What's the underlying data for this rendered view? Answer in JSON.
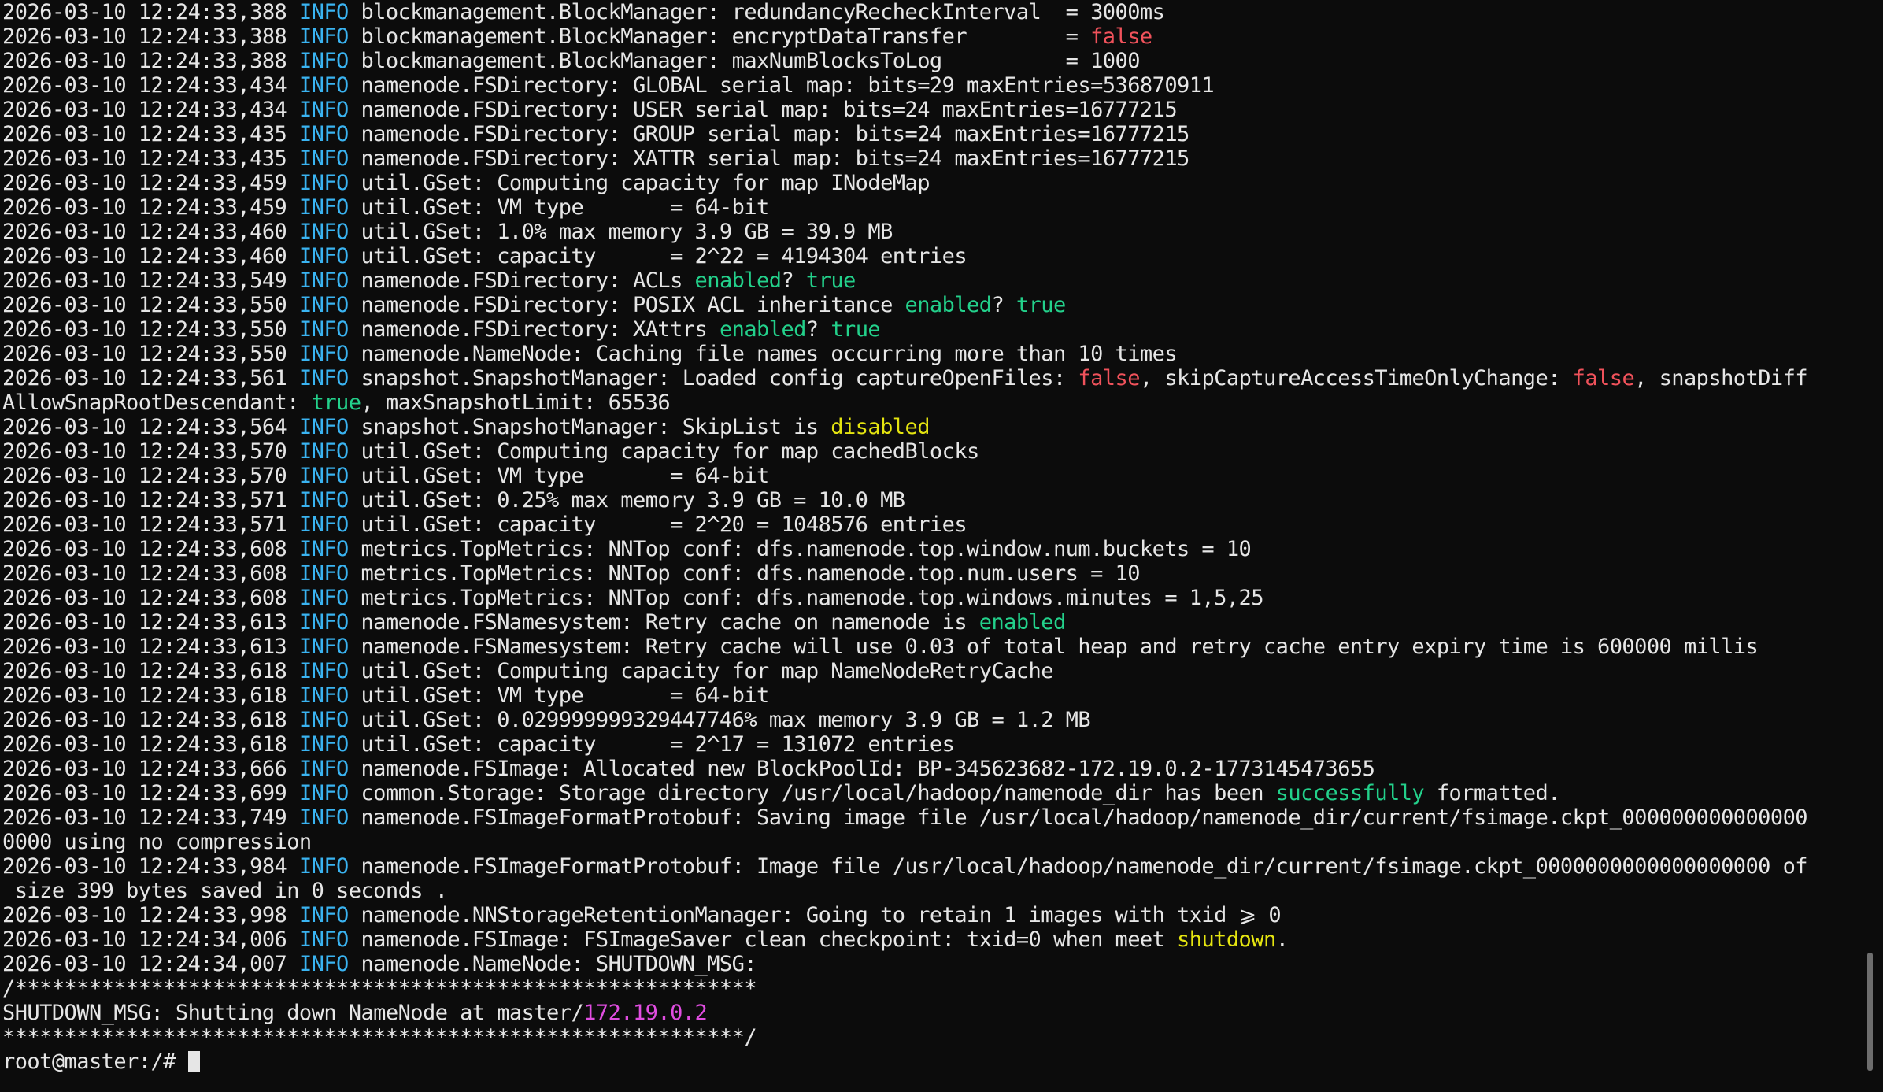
{
  "terminal": {
    "lines": [
      [
        {
          "t": "2026-03-10 12:24:33,388 ",
          "c": "plain"
        },
        {
          "t": "INFO",
          "c": "info"
        },
        {
          "t": " blockmanagement.BlockManager: redundancyRecheckInterval  = 3000ms",
          "c": "plain"
        }
      ],
      [
        {
          "t": "2026-03-10 12:24:33,388 ",
          "c": "plain"
        },
        {
          "t": "INFO",
          "c": "info"
        },
        {
          "t": " blockmanagement.BlockManager: encryptDataTransfer        = ",
          "c": "plain"
        },
        {
          "t": "false",
          "c": "red"
        }
      ],
      [
        {
          "t": "2026-03-10 12:24:33,388 ",
          "c": "plain"
        },
        {
          "t": "INFO",
          "c": "info"
        },
        {
          "t": " blockmanagement.BlockManager: maxNumBlocksToLog          = 1000",
          "c": "plain"
        }
      ],
      [
        {
          "t": "2026-03-10 12:24:33,434 ",
          "c": "plain"
        },
        {
          "t": "INFO",
          "c": "info"
        },
        {
          "t": " namenode.FSDirectory: GLOBAL serial map: bits=29 maxEntries=536870911",
          "c": "plain"
        }
      ],
      [
        {
          "t": "2026-03-10 12:24:33,434 ",
          "c": "plain"
        },
        {
          "t": "INFO",
          "c": "info"
        },
        {
          "t": " namenode.FSDirectory: USER serial map: bits=24 maxEntries=16777215",
          "c": "plain"
        }
      ],
      [
        {
          "t": "2026-03-10 12:24:33,435 ",
          "c": "plain"
        },
        {
          "t": "INFO",
          "c": "info"
        },
        {
          "t": " namenode.FSDirectory: GROUP serial map: bits=24 maxEntries=16777215",
          "c": "plain"
        }
      ],
      [
        {
          "t": "2026-03-10 12:24:33,435 ",
          "c": "plain"
        },
        {
          "t": "INFO",
          "c": "info"
        },
        {
          "t": " namenode.FSDirectory: XATTR serial map: bits=24 maxEntries=16777215",
          "c": "plain"
        }
      ],
      [
        {
          "t": "2026-03-10 12:24:33,459 ",
          "c": "plain"
        },
        {
          "t": "INFO",
          "c": "info"
        },
        {
          "t": " util.GSet: Computing capacity for map INodeMap",
          "c": "plain"
        }
      ],
      [
        {
          "t": "2026-03-10 12:24:33,459 ",
          "c": "plain"
        },
        {
          "t": "INFO",
          "c": "info"
        },
        {
          "t": " util.GSet: VM type       = 64-bit",
          "c": "plain"
        }
      ],
      [
        {
          "t": "2026-03-10 12:24:33,460 ",
          "c": "plain"
        },
        {
          "t": "INFO",
          "c": "info"
        },
        {
          "t": " util.GSet: 1.0% max memory 3.9 GB = 39.9 MB",
          "c": "plain"
        }
      ],
      [
        {
          "t": "2026-03-10 12:24:33,460 ",
          "c": "plain"
        },
        {
          "t": "INFO",
          "c": "info"
        },
        {
          "t": " util.GSet: capacity      = 2^22 = 4194304 entries",
          "c": "plain"
        }
      ],
      [
        {
          "t": "2026-03-10 12:24:33,549 ",
          "c": "plain"
        },
        {
          "t": "INFO",
          "c": "info"
        },
        {
          "t": " namenode.FSDirectory: ACLs ",
          "c": "plain"
        },
        {
          "t": "enabled",
          "c": "green"
        },
        {
          "t": "? ",
          "c": "plain"
        },
        {
          "t": "true",
          "c": "green"
        }
      ],
      [
        {
          "t": "2026-03-10 12:24:33,550 ",
          "c": "plain"
        },
        {
          "t": "INFO",
          "c": "info"
        },
        {
          "t": " namenode.FSDirectory: POSIX ACL inheritance ",
          "c": "plain"
        },
        {
          "t": "enabled",
          "c": "green"
        },
        {
          "t": "? ",
          "c": "plain"
        },
        {
          "t": "true",
          "c": "green"
        }
      ],
      [
        {
          "t": "2026-03-10 12:24:33,550 ",
          "c": "plain"
        },
        {
          "t": "INFO",
          "c": "info"
        },
        {
          "t": " namenode.FSDirectory: XAttrs ",
          "c": "plain"
        },
        {
          "t": "enabled",
          "c": "green"
        },
        {
          "t": "? ",
          "c": "plain"
        },
        {
          "t": "true",
          "c": "green"
        }
      ],
      [
        {
          "t": "2026-03-10 12:24:33,550 ",
          "c": "plain"
        },
        {
          "t": "INFO",
          "c": "info"
        },
        {
          "t": " namenode.NameNode: Caching file names occurring more than 10 times",
          "c": "plain"
        }
      ],
      [
        {
          "t": "2026-03-10 12:24:33,561 ",
          "c": "plain"
        },
        {
          "t": "INFO",
          "c": "info"
        },
        {
          "t": " snapshot.SnapshotManager: Loaded config captureOpenFiles: ",
          "c": "plain"
        },
        {
          "t": "false",
          "c": "red"
        },
        {
          "t": ", skipCaptureAccessTimeOnlyChange: ",
          "c": "plain"
        },
        {
          "t": "false",
          "c": "red"
        },
        {
          "t": ", snapshotDiff",
          "c": "plain"
        }
      ],
      [
        {
          "t": "AllowSnapRootDescendant: ",
          "c": "plain"
        },
        {
          "t": "true",
          "c": "green"
        },
        {
          "t": ", maxSnapshotLimit: 65536",
          "c": "plain"
        }
      ],
      [
        {
          "t": "2026-03-10 12:24:33,564 ",
          "c": "plain"
        },
        {
          "t": "INFO",
          "c": "info"
        },
        {
          "t": " snapshot.SnapshotManager: SkipList is ",
          "c": "plain"
        },
        {
          "t": "disabled",
          "c": "yellow"
        }
      ],
      [
        {
          "t": "2026-03-10 12:24:33,570 ",
          "c": "plain"
        },
        {
          "t": "INFO",
          "c": "info"
        },
        {
          "t": " util.GSet: Computing capacity for map cachedBlocks",
          "c": "plain"
        }
      ],
      [
        {
          "t": "2026-03-10 12:24:33,570 ",
          "c": "plain"
        },
        {
          "t": "INFO",
          "c": "info"
        },
        {
          "t": " util.GSet: VM type       = 64-bit",
          "c": "plain"
        }
      ],
      [
        {
          "t": "2026-03-10 12:24:33,571 ",
          "c": "plain"
        },
        {
          "t": "INFO",
          "c": "info"
        },
        {
          "t": " util.GSet: 0.25% max memory 3.9 GB = 10.0 MB",
          "c": "plain"
        }
      ],
      [
        {
          "t": "2026-03-10 12:24:33,571 ",
          "c": "plain"
        },
        {
          "t": "INFO",
          "c": "info"
        },
        {
          "t": " util.GSet: capacity      = 2^20 = 1048576 entries",
          "c": "plain"
        }
      ],
      [
        {
          "t": "2026-03-10 12:24:33,608 ",
          "c": "plain"
        },
        {
          "t": "INFO",
          "c": "info"
        },
        {
          "t": " metrics.TopMetrics: NNTop conf: dfs.namenode.top.window.num.buckets = 10",
          "c": "plain"
        }
      ],
      [
        {
          "t": "2026-03-10 12:24:33,608 ",
          "c": "plain"
        },
        {
          "t": "INFO",
          "c": "info"
        },
        {
          "t": " metrics.TopMetrics: NNTop conf: dfs.namenode.top.num.users = 10",
          "c": "plain"
        }
      ],
      [
        {
          "t": "2026-03-10 12:24:33,608 ",
          "c": "plain"
        },
        {
          "t": "INFO",
          "c": "info"
        },
        {
          "t": " metrics.TopMetrics: NNTop conf: dfs.namenode.top.windows.minutes = 1,5,25",
          "c": "plain"
        }
      ],
      [
        {
          "t": "2026-03-10 12:24:33,613 ",
          "c": "plain"
        },
        {
          "t": "INFO",
          "c": "info"
        },
        {
          "t": " namenode.FSNamesystem: Retry cache on namenode is ",
          "c": "plain"
        },
        {
          "t": "enabled",
          "c": "green"
        }
      ],
      [
        {
          "t": "2026-03-10 12:24:33,613 ",
          "c": "plain"
        },
        {
          "t": "INFO",
          "c": "info"
        },
        {
          "t": " namenode.FSNamesystem: Retry cache will use 0.03 of total heap and retry cache entry expiry time is 600000 millis",
          "c": "plain"
        }
      ],
      [
        {
          "t": "2026-03-10 12:24:33,618 ",
          "c": "plain"
        },
        {
          "t": "INFO",
          "c": "info"
        },
        {
          "t": " util.GSet: Computing capacity for map NameNodeRetryCache",
          "c": "plain"
        }
      ],
      [
        {
          "t": "2026-03-10 12:24:33,618 ",
          "c": "plain"
        },
        {
          "t": "INFO",
          "c": "info"
        },
        {
          "t": " util.GSet: VM type       = 64-bit",
          "c": "plain"
        }
      ],
      [
        {
          "t": "2026-03-10 12:24:33,618 ",
          "c": "plain"
        },
        {
          "t": "INFO",
          "c": "info"
        },
        {
          "t": " util.GSet: 0.029999999329447746% max memory 3.9 GB = 1.2 MB",
          "c": "plain"
        }
      ],
      [
        {
          "t": "2026-03-10 12:24:33,618 ",
          "c": "plain"
        },
        {
          "t": "INFO",
          "c": "info"
        },
        {
          "t": " util.GSet: capacity      = 2^17 = 131072 entries",
          "c": "plain"
        }
      ],
      [
        {
          "t": "2026-03-10 12:24:33,666 ",
          "c": "plain"
        },
        {
          "t": "INFO",
          "c": "info"
        },
        {
          "t": " namenode.FSImage: Allocated new BlockPoolId: BP-345623682-172.19.0.2-1773145473655",
          "c": "plain"
        }
      ],
      [
        {
          "t": "2026-03-10 12:24:33,699 ",
          "c": "plain"
        },
        {
          "t": "INFO",
          "c": "info"
        },
        {
          "t": " common.Storage: Storage directory /usr/local/hadoop/namenode_dir has been ",
          "c": "plain"
        },
        {
          "t": "successfully",
          "c": "green"
        },
        {
          "t": " formatted.",
          "c": "plain"
        }
      ],
      [
        {
          "t": "2026-03-10 12:24:33,749 ",
          "c": "plain"
        },
        {
          "t": "INFO",
          "c": "info"
        },
        {
          "t": " namenode.FSImageFormatProtobuf: Saving image file /usr/local/hadoop/namenode_dir/current/fsimage.ckpt_000000000000000",
          "c": "plain"
        }
      ],
      [
        {
          "t": "0000 using no compression",
          "c": "plain"
        }
      ],
      [
        {
          "t": "2026-03-10 12:24:33,984 ",
          "c": "plain"
        },
        {
          "t": "INFO",
          "c": "info"
        },
        {
          "t": " namenode.FSImageFormatProtobuf: Image file /usr/local/hadoop/namenode_dir/current/fsimage.ckpt_0000000000000000000 of",
          "c": "plain"
        }
      ],
      [
        {
          "t": " size 399 bytes saved in 0 seconds .",
          "c": "plain"
        }
      ],
      [
        {
          "t": "2026-03-10 12:24:33,998 ",
          "c": "plain"
        },
        {
          "t": "INFO",
          "c": "info"
        },
        {
          "t": " namenode.NNStorageRetentionManager: Going to retain 1 images with txid ⩾ 0",
          "c": "plain"
        }
      ],
      [
        {
          "t": "2026-03-10 12:24:34,006 ",
          "c": "plain"
        },
        {
          "t": "INFO",
          "c": "info"
        },
        {
          "t": " namenode.FSImage: FSImageSaver clean checkpoint: txid=0 when meet ",
          "c": "plain"
        },
        {
          "t": "shutdown",
          "c": "yellow"
        },
        {
          "t": ".",
          "c": "plain"
        }
      ],
      [
        {
          "t": "2026-03-10 12:24:34,007 ",
          "c": "plain"
        },
        {
          "t": "INFO",
          "c": "info"
        },
        {
          "t": " namenode.NameNode: SHUTDOWN_MSG:",
          "c": "plain"
        }
      ],
      [
        {
          "t": "/************************************************************",
          "c": "plain"
        }
      ],
      [
        {
          "t": "SHUTDOWN_MSG: Shutting down NameNode at master/",
          "c": "plain"
        },
        {
          "t": "172.19.0.2",
          "c": "magenta"
        }
      ],
      [
        {
          "t": "************************************************************/",
          "c": "plain"
        }
      ]
    ],
    "prompt": "root@master:/# ",
    "colors": {
      "background": "#0c0c0c",
      "foreground": "#e6e6e6",
      "info": "#3ab4f2",
      "red": "#f0525b",
      "green": "#23d18b",
      "yellow": "#e5e510",
      "magenta": "#e04de0"
    }
  }
}
